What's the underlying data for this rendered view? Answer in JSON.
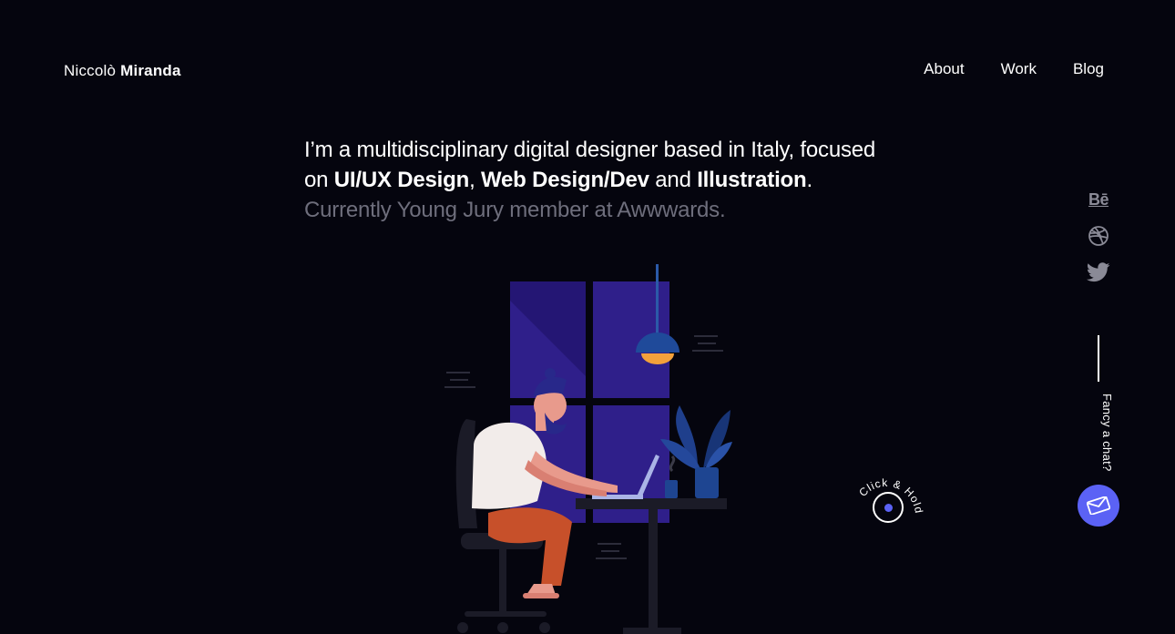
{
  "brand": {
    "first_name": "Niccolò",
    "last_name": "Miranda"
  },
  "nav": {
    "items": [
      "About",
      "Work",
      "Blog"
    ]
  },
  "intro": {
    "line1": "I’m a multidisciplinary digital designer based in Italy, focused",
    "line2_prefix": "on ",
    "skill1": "UI/UX Design",
    "sep1": ", ",
    "skill2": "Web Design/Dev",
    "sep2": " and ",
    "skill3": "Illustration",
    "end": ".",
    "line3": "Currently Young Jury member at Awwwards."
  },
  "social": {
    "behance_label": "Bē",
    "icons": [
      "behance-icon",
      "dribbble-icon",
      "twitter-icon"
    ]
  },
  "chat": {
    "label": "Fancy a chat?",
    "icon": "envelope-icon"
  },
  "click_hold": {
    "label": "Click & Hold"
  },
  "colors": {
    "background": "#05050e",
    "accent": "#5b62f5",
    "muted_text": "#6e6e7c",
    "window": "#2f1f8a",
    "lamp_glow": "#f3a13b",
    "pants": "#c7502a",
    "plant": "#1f3f8c"
  }
}
